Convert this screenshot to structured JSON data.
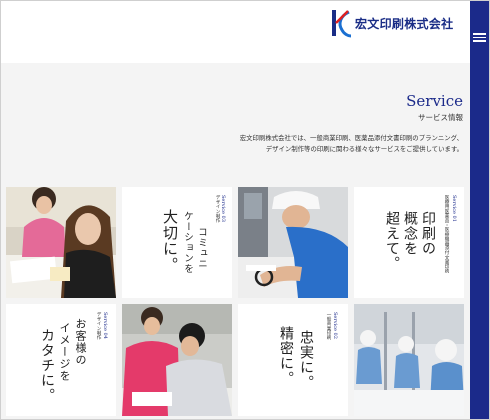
{
  "header": {
    "logo_text": "宏文印刷株式会社"
  },
  "service": {
    "title": "Service",
    "subtitle": "サービス情報",
    "desc_line1": "宏文印刷株式会社では、一般商業印刷、医薬品添付文書印刷のプランニング、",
    "desc_line2": "デザイン制作等の印刷に関わる様々なサービスをご提供しています。"
  },
  "tiles": {
    "t1": {
      "label": "Service 03",
      "category": "デザイン制作",
      "heading_col1": "コミュニ",
      "heading_col2": "ケーションを",
      "heading_col3": "大切に。"
    },
    "t2": {
      "label": "Service 01",
      "category": "医療用医薬品・医療機器添付文書印刷",
      "heading_col1": "印刷の",
      "heading_col2": "概念を",
      "heading_col3": "超えて。"
    },
    "t3": {
      "label": "Service 04",
      "category": "デザイン制作",
      "heading_col1": "お客様の",
      "heading_col2": "イメージを",
      "heading_col3": "カタチに。"
    },
    "t4": {
      "label": "Service 02",
      "category": "一般商業印刷",
      "heading_col1": "忠実に。",
      "heading_col2": "精密に。"
    }
  },
  "colors": {
    "brand_navy": "#1b2a8a",
    "hero_bg": "#f4f4f4"
  }
}
